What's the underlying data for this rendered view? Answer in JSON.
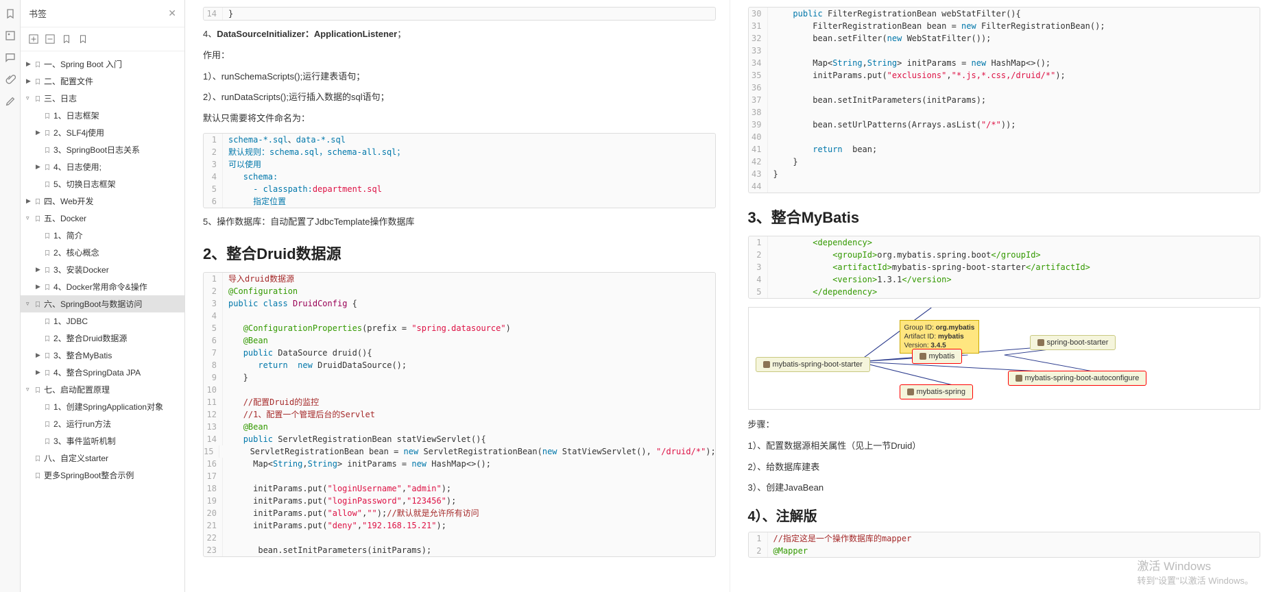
{
  "sidebar": {
    "title": "书签",
    "items": [
      {
        "label": "一、Spring Boot 入门",
        "depth": 0,
        "arrow": "▶"
      },
      {
        "label": "二、配置文件",
        "depth": 0,
        "arrow": "▶"
      },
      {
        "label": "三、日志",
        "depth": 0,
        "arrow": "▿"
      },
      {
        "label": "1、日志框架",
        "depth": 1,
        "arrow": ""
      },
      {
        "label": "2、SLF4j使用",
        "depth": 1,
        "arrow": "▶"
      },
      {
        "label": "3、SpringBoot日志关系",
        "depth": 1,
        "arrow": ""
      },
      {
        "label": "4、日志使用;",
        "depth": 1,
        "arrow": "▶"
      },
      {
        "label": "5、切换日志框架",
        "depth": 1,
        "arrow": ""
      },
      {
        "label": "四、Web开发",
        "depth": 0,
        "arrow": "▶"
      },
      {
        "label": "五、Docker",
        "depth": 0,
        "arrow": "▿"
      },
      {
        "label": "1、简介",
        "depth": 1,
        "arrow": ""
      },
      {
        "label": "2、核心概念",
        "depth": 1,
        "arrow": ""
      },
      {
        "label": "3、安装Docker",
        "depth": 1,
        "arrow": "▶"
      },
      {
        "label": "4、Docker常用命令&操作",
        "depth": 1,
        "arrow": "▶"
      },
      {
        "label": "六、SpringBoot与数据访问",
        "depth": 0,
        "arrow": "▿",
        "selected": true
      },
      {
        "label": "1、JDBC",
        "depth": 1,
        "arrow": ""
      },
      {
        "label": "2、整合Druid数据源",
        "depth": 1,
        "arrow": ""
      },
      {
        "label": "3、整合MyBatis",
        "depth": 1,
        "arrow": "▶"
      },
      {
        "label": "4、整合SpringData JPA",
        "depth": 1,
        "arrow": "▶"
      },
      {
        "label": "七、启动配置原理",
        "depth": 0,
        "arrow": "▿"
      },
      {
        "label": "1、创建SpringApplication对象",
        "depth": 1,
        "arrow": ""
      },
      {
        "label": "2、运行run方法",
        "depth": 1,
        "arrow": ""
      },
      {
        "label": "3、事件监听机制",
        "depth": 1,
        "arrow": ""
      },
      {
        "label": "八、自定义starter",
        "depth": 0,
        "arrow": ""
      },
      {
        "label": "更多SpringBoot整合示例",
        "depth": 0,
        "arrow": ""
      }
    ]
  },
  "left": {
    "code0": {
      "lines": [
        {
          "n": "14",
          "t": "}"
        }
      ]
    },
    "p1_prefix": "4、",
    "p1_bold": "DataSourceInitializer：ApplicationListener",
    "p1_suffix": "；",
    "p2": "作用：",
    "p3": "1）、runSchemaScripts();运行建表语句；",
    "p4": "2）、runDataScripts();运行插入数据的sql语句；",
    "p5": "默认只需要将文件命名为：",
    "code1": {
      "lines": [
        {
          "n": "1",
          "h": "<span class='k-blue'>schema-*.sql</span>、<span class='k-blue'>data-*.sql</span>"
        },
        {
          "n": "2",
          "h": "<span class='k-blue'>默认规则：schema.sql，schema-all.sql；</span>"
        },
        {
          "n": "3",
          "h": "<span class='k-blue'>可以使用</span>"
        },
        {
          "n": "4",
          "h": "   <span class='k-blue'>schema:</span>"
        },
        {
          "n": "5",
          "h": "     <span class='k-blue'>- classpath:</span><span class='k-orange'>department.sql</span>"
        },
        {
          "n": "6",
          "h": "     <span class='k-blue'>指定位置</span>"
        }
      ]
    },
    "p6": "5、操作数据库：自动配置了JdbcTemplate操作数据库",
    "h2": "2、整合Druid数据源",
    "code2": {
      "lines": [
        {
          "n": "1",
          "h": "<span class='k-brown'>导入druid数据源</span>"
        },
        {
          "n": "2",
          "h": "<span class='k-green'>@Configuration</span>"
        },
        {
          "n": "3",
          "h": "<span class='k-blue'>public</span> <span class='k-blue'>class</span> <span class='k-purple'>DruidConfig</span> {"
        },
        {
          "n": "4",
          "h": ""
        },
        {
          "n": "5",
          "h": "   <span class='k-green'>@ConfigurationProperties</span>(prefix = <span class='k-orange'>\"spring.datasource\"</span>)"
        },
        {
          "n": "6",
          "h": "   <span class='k-green'>@Bean</span>"
        },
        {
          "n": "7",
          "h": "   <span class='k-blue'>public</span> DataSource druid(){"
        },
        {
          "n": "8",
          "h": "      <span class='k-blue'>return</span>  <span class='k-blue'>new</span> DruidDataSource();"
        },
        {
          "n": "9",
          "h": "   }"
        },
        {
          "n": "10",
          "h": ""
        },
        {
          "n": "11",
          "h": "   <span class='k-brown'>//配置Druid的监控</span>"
        },
        {
          "n": "12",
          "h": "   <span class='k-brown'>//1、配置一个管理后台的Servlet</span>"
        },
        {
          "n": "13",
          "h": "   <span class='k-green'>@Bean</span>"
        },
        {
          "n": "14",
          "h": "   <span class='k-blue'>public</span> ServletRegistrationBean statViewServlet(){"
        },
        {
          "n": "15",
          "h": "     ServletRegistrationBean bean = <span class='k-blue'>new</span> ServletRegistrationBean(<span class='k-blue'>new</span> StatViewServlet(), <span class='k-orange'>\"/druid/*\"</span>);"
        },
        {
          "n": "16",
          "h": "     Map&lt;<span class='k-blue'>String</span>,<span class='k-blue'>String</span>&gt; initParams = <span class='k-blue'>new</span> HashMap&lt;&gt;();"
        },
        {
          "n": "17",
          "h": ""
        },
        {
          "n": "18",
          "h": "     initParams.put(<span class='k-orange'>\"loginUsername\"</span>,<span class='k-orange'>\"admin\"</span>);"
        },
        {
          "n": "19",
          "h": "     initParams.put(<span class='k-orange'>\"loginPassword\"</span>,<span class='k-orange'>\"123456\"</span>);"
        },
        {
          "n": "20",
          "h": "     initParams.put(<span class='k-orange'>\"allow\"</span>,<span class='k-orange'>\"\"</span>);<span class='k-brown'>//默认就是允许所有访问</span>"
        },
        {
          "n": "21",
          "h": "     initParams.put(<span class='k-orange'>\"deny\"</span>,<span class='k-orange'>\"192.168.15.21\"</span>);"
        },
        {
          "n": "22",
          "h": ""
        },
        {
          "n": "23",
          "h": "      bean.setInitParameters(initParams);"
        }
      ]
    }
  },
  "right": {
    "code0": {
      "lines": [
        {
          "n": "30",
          "h": "    <span class='k-blue'>public</span> FilterRegistrationBean webStatFilter(){"
        },
        {
          "n": "31",
          "h": "        FilterRegistrationBean bean = <span class='k-blue'>new</span> FilterRegistrationBean();"
        },
        {
          "n": "32",
          "h": "        bean.setFilter(<span class='k-blue'>new</span> WebStatFilter());"
        },
        {
          "n": "33",
          "h": ""
        },
        {
          "n": "34",
          "h": "        Map&lt;<span class='k-blue'>String</span>,<span class='k-blue'>String</span>&gt; initParams = <span class='k-blue'>new</span> HashMap&lt;&gt;();"
        },
        {
          "n": "35",
          "h": "        initParams.put(<span class='k-orange'>\"exclusions\"</span>,<span class='k-orange'>\"*.js,*.css,/druid/*\"</span>);"
        },
        {
          "n": "36",
          "h": ""
        },
        {
          "n": "37",
          "h": "        bean.setInitParameters(initParams);"
        },
        {
          "n": "38",
          "h": ""
        },
        {
          "n": "39",
          "h": "        bean.setUrlPatterns(Arrays.asList(<span class='k-orange'>\"/*\"</span>));"
        },
        {
          "n": "40",
          "h": ""
        },
        {
          "n": "41",
          "h": "        <span class='k-blue'>return</span>  bean;"
        },
        {
          "n": "42",
          "h": "    }"
        },
        {
          "n": "43",
          "h": "}"
        },
        {
          "n": "44",
          "h": ""
        }
      ]
    },
    "h2": "3、整合MyBatis",
    "code1": {
      "lines": [
        {
          "n": "1",
          "h": "        <span class='k-green'>&lt;dependency&gt;</span>"
        },
        {
          "n": "2",
          "h": "            <span class='k-green'>&lt;groupId&gt;</span>org.mybatis.spring.boot<span class='k-green'>&lt;/groupId&gt;</span>"
        },
        {
          "n": "3",
          "h": "            <span class='k-green'>&lt;artifactId&gt;</span>mybatis-spring-boot-starter<span class='k-green'>&lt;/artifactId&gt;</span>"
        },
        {
          "n": "4",
          "h": "            <span class='k-green'>&lt;version&gt;</span>1.3.1<span class='k-green'>&lt;/version&gt;</span>"
        },
        {
          "n": "5",
          "h": "        <span class='k-green'>&lt;/dependency&gt;</span>"
        }
      ]
    },
    "diagram": {
      "tooltip_l1": "Group ID: ",
      "tooltip_b1": "org.mybatis",
      "tooltip_l2": "Artifact ID: ",
      "tooltip_b2": "mybatis",
      "tooltip_l3": "Version: ",
      "tooltip_b3": "3.4.5",
      "n1": "mybatis-spring-boot-starter",
      "n2": "mybatis",
      "n3": "mybatis-spring",
      "n4": "spring-boot-starter",
      "n5": "mybatis-spring-boot-autoconfigure"
    },
    "p1": "步骤：",
    "p2": "1）、配置数据源相关属性（见上一节Druid）",
    "p3": "2）、给数据库建表",
    "p4": "3）、创建JavaBean",
    "h3": "4）、注解版",
    "code2": {
      "lines": [
        {
          "n": "1",
          "h": "<span class='k-brown'>//指定这是一个操作数据库的mapper</span>"
        },
        {
          "n": "2",
          "h": "<span class='k-green'>@Mapper</span>"
        }
      ]
    }
  },
  "watermark": {
    "l1": "激活 Windows",
    "l2": "转到\"设置\"以激活 Windows。"
  }
}
